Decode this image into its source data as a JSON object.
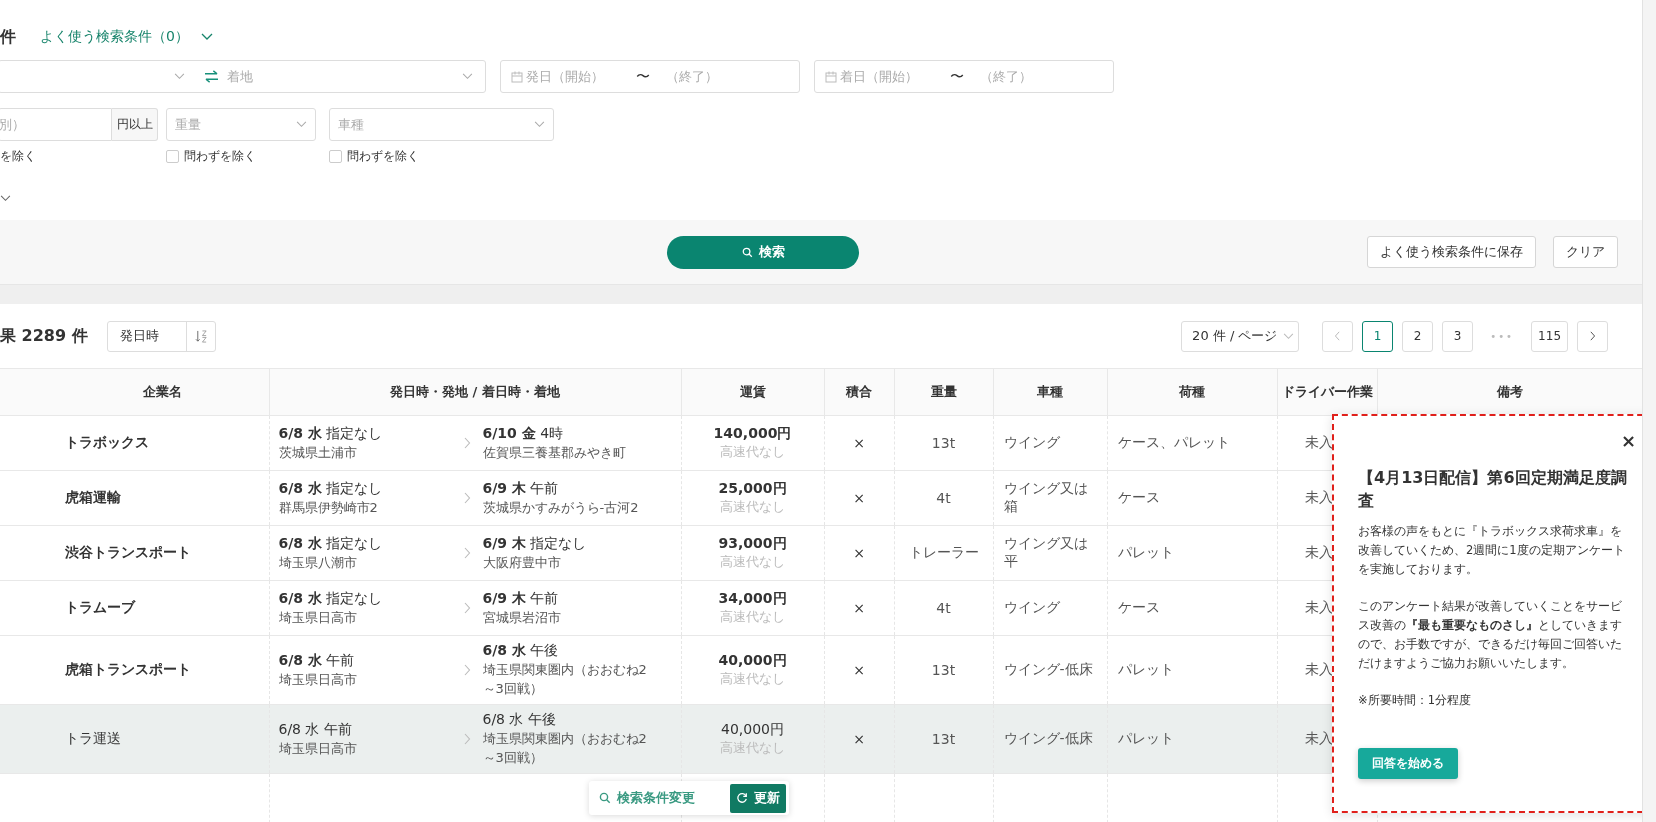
{
  "header": {
    "title": "件",
    "saved_conditions_link": "よく使う検索条件（0）"
  },
  "filters": {
    "route": {
      "placeholder": "着地"
    },
    "departure_date": {
      "start": "発日（開始）",
      "separator": "〜",
      "end": "（終了）"
    },
    "arrival_date": {
      "start": "着日（開始）",
      "separator": "〜",
      "end": "（終了）"
    },
    "fare": {
      "placeholder": "別）",
      "unit": "円以上",
      "exclude_label": "を除く"
    },
    "selects": [
      {
        "placeholder": "重量",
        "exclude_label": "問わずを除く",
        "checked": false
      },
      {
        "placeholder": "車種",
        "exclude_label": "問わずを除く",
        "checked": false
      }
    ]
  },
  "actions": {
    "search": "検索",
    "save": "よく使う検索条件に保存",
    "clear": "クリア"
  },
  "results": {
    "count": "果 2289 件",
    "sort": "発日時",
    "page_size": "20 件 / ページ",
    "pages": [
      {
        "kind": "page",
        "label": "1",
        "selected": true
      },
      {
        "kind": "page",
        "label": "2",
        "selected": false
      },
      {
        "kind": "page",
        "label": "3",
        "selected": false
      },
      {
        "kind": "ellipsis",
        "label": "•••",
        "selected": false
      },
      {
        "kind": "page",
        "label": "115",
        "selected": false
      }
    ]
  },
  "table": {
    "columns": [
      "企業名",
      "発日時・発地 / 着日時・着地",
      "運賃",
      "積合",
      "重量",
      "車種",
      "荷種",
      "ドライバー作業",
      "備考"
    ],
    "rows": [
      {
        "company": "トラボックス",
        "depart_date": "6/8 水",
        "depart_time": "指定なし",
        "depart_place": "茨城県土浦市",
        "arrive_date": "6/10 金",
        "arrive_time": "4時",
        "arrive_place": "佐賀県三養基郡みやき町",
        "fare": "140,000円",
        "toll": "高速代なし",
        "mixed": "×",
        "weight": "13t",
        "vehicle": "ウイング",
        "cargo": "ケース、パレット",
        "driver_work": "未入",
        "highlighted": false
      },
      {
        "company": "虎箱運輸",
        "depart_date": "6/8 水",
        "depart_time": "指定なし",
        "depart_place": "群馬県伊勢崎市2",
        "arrive_date": "6/9 木",
        "arrive_time": "午前",
        "arrive_place": "茨城県かすみがうら-古河2",
        "fare": "25,000円",
        "toll": "高速代なし",
        "mixed": "×",
        "weight": "4t",
        "vehicle": "ウイング又は箱",
        "cargo": "ケース",
        "driver_work": "未入",
        "highlighted": false
      },
      {
        "company": "渋谷トランスポート",
        "depart_date": "6/8 水",
        "depart_time": "指定なし",
        "depart_place": "埼玉県八潮市",
        "arrive_date": "6/9 木",
        "arrive_time": "指定なし",
        "arrive_place": "大阪府豊中市",
        "fare": "93,000円",
        "toll": "高速代なし",
        "mixed": "×",
        "weight": "トレーラー",
        "vehicle": "ウイング又は平",
        "cargo": "パレット",
        "driver_work": "未入",
        "highlighted": false
      },
      {
        "company": "トラムーブ",
        "depart_date": "6/8 水",
        "depart_time": "指定なし",
        "depart_place": "埼玉県日高市",
        "arrive_date": "6/9 木",
        "arrive_time": "午前",
        "arrive_place": "宮城県岩沼市",
        "fare": "34,000円",
        "toll": "高速代なし",
        "mixed": "×",
        "weight": "4t",
        "vehicle": "ウイング",
        "cargo": "ケース",
        "driver_work": "未入",
        "highlighted": false
      },
      {
        "company": "虎箱トランスポート",
        "depart_date": "6/8 水",
        "depart_time": "午前",
        "depart_place": "埼玉県日高市",
        "arrive_date": "6/8 水",
        "arrive_time": "午後",
        "arrive_place": "埼玉県関東圏内（おおむね2～3回戦）",
        "fare": "40,000円",
        "toll": "高速代なし",
        "mixed": "×",
        "weight": "13t",
        "vehicle": "ウイング-低床",
        "cargo": "パレット",
        "driver_work": "未入",
        "highlighted": false
      },
      {
        "company": "トラ運送",
        "depart_date": "6/8 水",
        "depart_time": "午前",
        "depart_place": "埼玉県日高市",
        "arrive_date": "6/8 水",
        "arrive_time": "午後",
        "arrive_place": "埼玉県関東圏内（おおむね2～3回戦）",
        "fare": "40,000円",
        "toll": "高速代なし",
        "mixed": "×",
        "weight": "13t",
        "vehicle": "ウイング-低床",
        "cargo": "パレット",
        "driver_work": "未入",
        "highlighted": true
      }
    ]
  },
  "floating_bar": {
    "link": "検索条件変更",
    "button": "更新"
  },
  "survey_popup": {
    "close": "×",
    "title": "【4月13日配信】第6回定期満足度調査",
    "paragraphs": [
      "お客様の声をもとに『トラボックス求荷求車』を改善していくため、2週間に1度の定期アンケートを実施しております。",
      "このアンケート結果が改善していくことをサービス改善の**『最も重要なものさし』**としていきますので、お手数ですが、できるだけ毎回ご回答いただけますようご協力お願いいたします。",
      "※所要時間：1分程度"
    ],
    "button": "回答を始める"
  }
}
